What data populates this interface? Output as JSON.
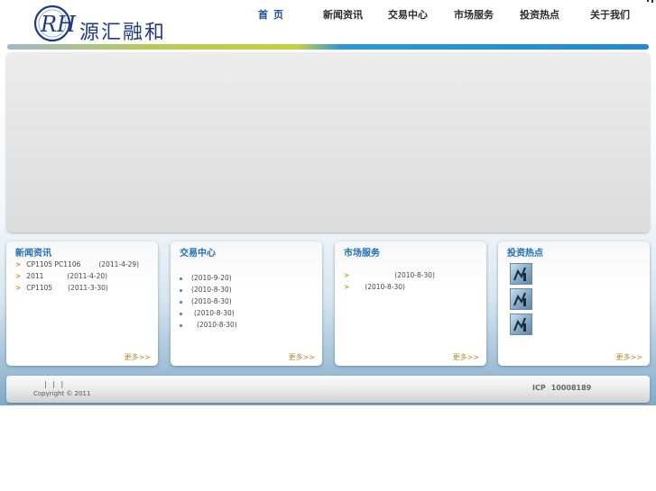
{
  "brand": {
    "name": "源汇融和",
    "mark": "RH"
  },
  "nav": {
    "items": [
      {
        "label": "首页",
        "active": true
      },
      {
        "label": "新闻资讯"
      },
      {
        "label": "交易中心"
      },
      {
        "label": "市场服务"
      },
      {
        "label": "投资热点"
      },
      {
        "label": "关于我们"
      }
    ]
  },
  "panels": {
    "news": {
      "title": "新闻资讯",
      "more": "更多>>",
      "items": [
        {
          "bullet": ">",
          "text": "CP1105 PC1106",
          "date": "(2011-4-29)"
        },
        {
          "bullet": ">",
          "text": "2011",
          "date": "(2011-4-20)"
        },
        {
          "bullet": ">",
          "text": "CP1105",
          "date": "(2011-3-30)"
        }
      ]
    },
    "trade": {
      "title": "交易中心",
      "more": "更多>>",
      "items": [
        {
          "date": "(2010-9-20)"
        },
        {
          "date": "(2010-8-30)"
        },
        {
          "date": "(2010-8-30)"
        },
        {
          "date": "(2010-8-30)"
        },
        {
          "date": "(2010-8-30)"
        }
      ]
    },
    "market": {
      "title": "市场服务",
      "more": "更多>>",
      "items": [
        {
          "bullet": ">",
          "date": "(2010-8-30)"
        },
        {
          "bullet": ">",
          "date": "(2010-8-30)"
        }
      ]
    },
    "hotspot": {
      "title": "投资热点",
      "more": "更多>>",
      "thumbs": [
        "chart-thumbnail-icon",
        "chart-thumbnail-icon",
        "chart-thumbnail-icon"
      ]
    }
  },
  "footer": {
    "separators": "| | |",
    "copyright": "Copyright © 2011",
    "icp_label": "ICP",
    "icp_number": "10008189"
  },
  "colors": {
    "brand_blue": "#1d3b86",
    "title_blue": "#1e6fb5",
    "more_gold": "#b48c2b",
    "rule_green": "#c6d23a",
    "rule_blue": "#1e8ccf"
  }
}
